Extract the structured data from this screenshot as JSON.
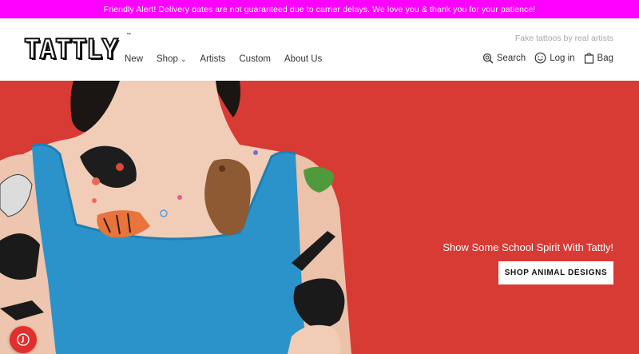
{
  "alert": {
    "text": "Friendly Alert! Delivery dates are not guaranteed due to carrier delays. We love you & thank you for your patience!"
  },
  "header": {
    "logo_text": "TATTLY",
    "logo_tm": "™",
    "tagline": "Fake tattoos by real artists",
    "nav": [
      {
        "label": "New"
      },
      {
        "label": "Shop"
      },
      {
        "label": "Artists"
      },
      {
        "label": "Custom"
      },
      {
        "label": "About Us"
      }
    ],
    "search_label": "Search",
    "login_label": "Log in",
    "bag_label": "Bag"
  },
  "hero": {
    "headline": "Show Some School Spirit With Tattly!",
    "cta_label": "SHOP ANIMAL DESIGNS",
    "background_color": "#d83a34"
  },
  "colors": {
    "alert_bg": "#ff00ff",
    "hero_bg": "#d83a34",
    "tank_top": "#2b93c9"
  },
  "icons": [
    "search-icon",
    "smiley-icon",
    "bag-icon",
    "chevron-down-icon",
    "chat-icon"
  ]
}
